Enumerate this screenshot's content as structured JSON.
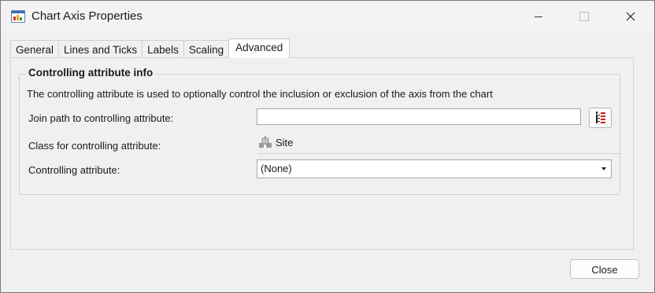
{
  "window": {
    "title": "Chart Axis Properties",
    "icon": "chart-icon"
  },
  "tabs": [
    {
      "label": "General",
      "active": false
    },
    {
      "label": "Lines and Ticks",
      "active": false
    },
    {
      "label": "Labels",
      "active": false
    },
    {
      "label": "Scaling",
      "active": false
    },
    {
      "label": "Advanced",
      "active": true
    }
  ],
  "group": {
    "title": "Controlling attribute info",
    "description": "The controlling attribute is used to optionally control the inclusion or exclusion of the axis from the chart",
    "join_path": {
      "label": "Join path to controlling attribute:",
      "value": "",
      "browse_icon": "tree-browse-icon"
    },
    "class": {
      "label": "Class for controlling attribute:",
      "value": "Site",
      "icon": "site-icon"
    },
    "controlling_attribute": {
      "label": "Controlling attribute:",
      "selected": "(None)"
    }
  },
  "footer": {
    "close_label": "Close"
  },
  "colors": {
    "window_bg": "#f0f0f0",
    "active_tab_bg": "#ffffff",
    "browse_icon_red": "#c8201e",
    "browse_icon_dark": "#222222"
  }
}
